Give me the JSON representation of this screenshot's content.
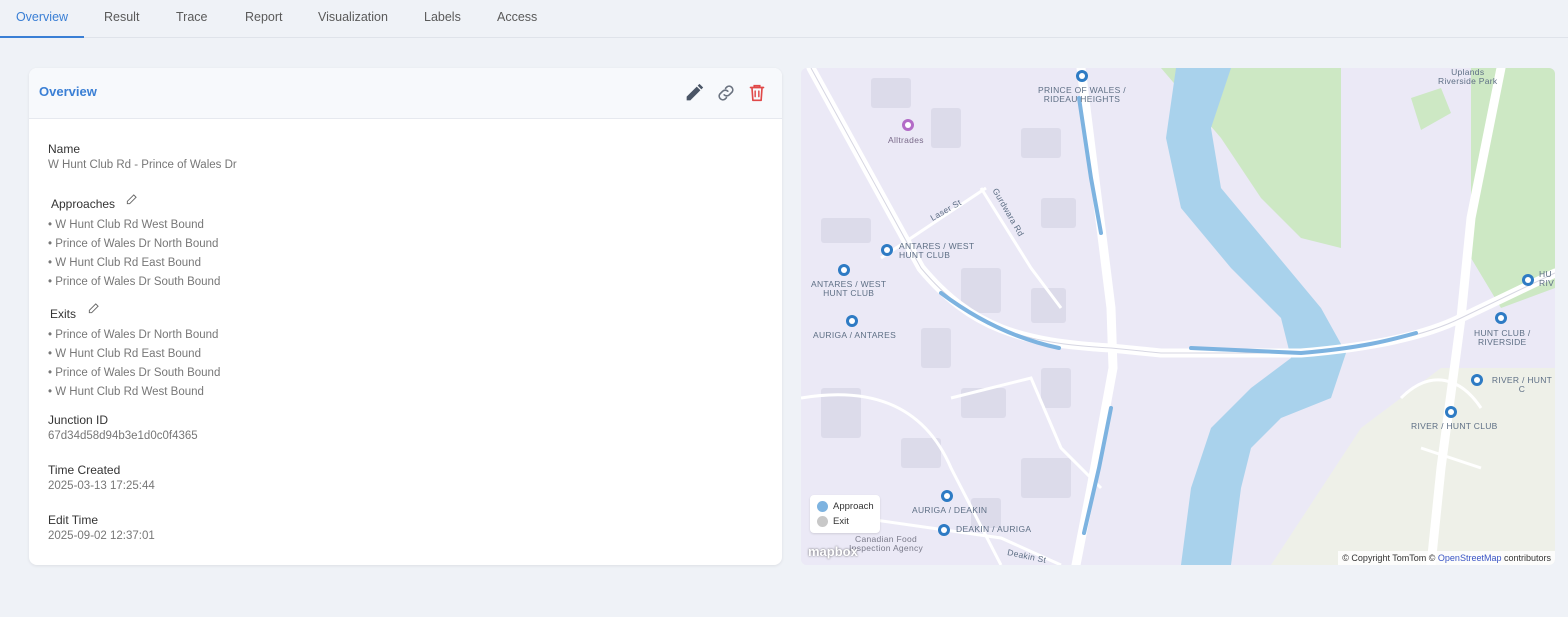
{
  "tabs": [
    "Overview",
    "Result",
    "Trace",
    "Report",
    "Visualization",
    "Labels",
    "Access"
  ],
  "active_tab": "Overview",
  "card": {
    "title": "Overview",
    "name_label": "Name",
    "name_value": "W Hunt Club Rd - Prince of Wales Dr",
    "approaches_label": "Approaches",
    "approaches": [
      "• W Hunt Club Rd West Bound",
      "• Prince of Wales Dr North Bound",
      "• W Hunt Club Rd East Bound",
      "• Prince of Wales Dr South Bound"
    ],
    "exits_label": "Exits",
    "exits": [
      "• Prince of Wales Dr North Bound",
      "• W Hunt Club Rd East Bound",
      "• Prince of Wales Dr South Bound",
      "• W Hunt Club Rd West Bound"
    ],
    "junction_id_label": "Junction ID",
    "junction_id_value": "67d34d58d94b3e1d0c0f4365",
    "time_created_label": "Time Created",
    "time_created_value": "2025-03-13 17:25:44",
    "edit_time_label": "Edit Time",
    "edit_time_value": "2025-09-02 12:37:01",
    "icons": [
      "edit-icon",
      "link-icon",
      "delete-icon"
    ]
  },
  "map": {
    "labels": {
      "prince_rideau": "PRINCE OF WALES /\nRIDEAU HEIGHTS",
      "alltrades": "Alltrades",
      "laser": "Laser St",
      "gurdwara": "Gurdwara Rd",
      "antares_west_1": "ANTARES / WEST\nHUNT CLUB",
      "antares_west_2": "ANTARES / WEST\nHUNT CLUB",
      "auriga_antares": "AURIGA / ANTARES",
      "uplands": "Uplands\nRiverside Park",
      "hunt_riverside": "HUNT CLUB /\nRIVERSIDE",
      "river_hunt_c": "RIVER / HUNT C",
      "river_hunt_club": "RIVER / HUNT CLUB",
      "hu_ri": "HU\nRIV",
      "auriga_deakin": "AURIGA / DEAKIN",
      "deakin_auriga": "DEAKIN / AURIGA",
      "canadian_food": "Canadian Food\nInspection Agency",
      "deakin_st": "Deakin St"
    },
    "legend": {
      "approach": "Approach",
      "exit": "Exit"
    },
    "logo": "mapbox",
    "attribution_prefix": "© Copyright TomTom © ",
    "attribution_link": "OpenStreetMap",
    "attribution_suffix": " contributors",
    "colors": {
      "approach": "#7db3e0",
      "exit": "#c8c8c8",
      "water": "#a9d2ec",
      "park": "#cde8c4",
      "land": "#ebe9f6"
    }
  }
}
